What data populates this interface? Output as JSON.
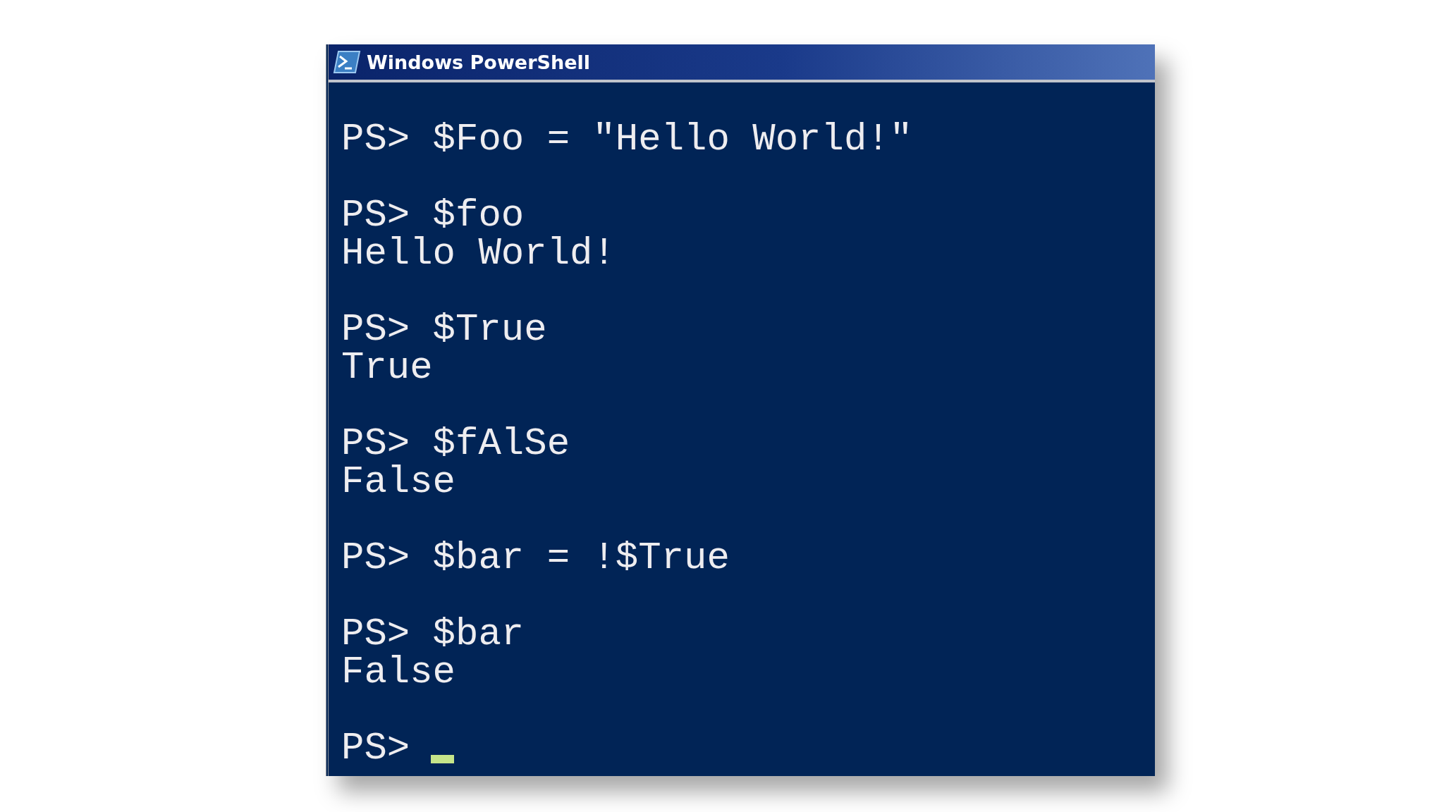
{
  "window": {
    "title": "Windows PowerShell"
  },
  "console": {
    "lines": [
      {
        "kind": "blank"
      },
      {
        "kind": "input",
        "text": "PS> $Foo = \"Hello World!\""
      },
      {
        "kind": "blank"
      },
      {
        "kind": "input",
        "text": "PS> $foo"
      },
      {
        "kind": "output",
        "text": "Hello World!"
      },
      {
        "kind": "blank"
      },
      {
        "kind": "input",
        "text": "PS> $True"
      },
      {
        "kind": "output",
        "text": "True"
      },
      {
        "kind": "blank"
      },
      {
        "kind": "input",
        "text": "PS> $fAlSe"
      },
      {
        "kind": "output",
        "text": "False"
      },
      {
        "kind": "blank"
      },
      {
        "kind": "input",
        "text": "PS> $bar = !$True"
      },
      {
        "kind": "blank"
      },
      {
        "kind": "input",
        "text": "PS> $bar"
      },
      {
        "kind": "output",
        "text": "False"
      },
      {
        "kind": "blank"
      },
      {
        "kind": "prompt",
        "text": "PS>",
        "cursor": true
      }
    ]
  }
}
